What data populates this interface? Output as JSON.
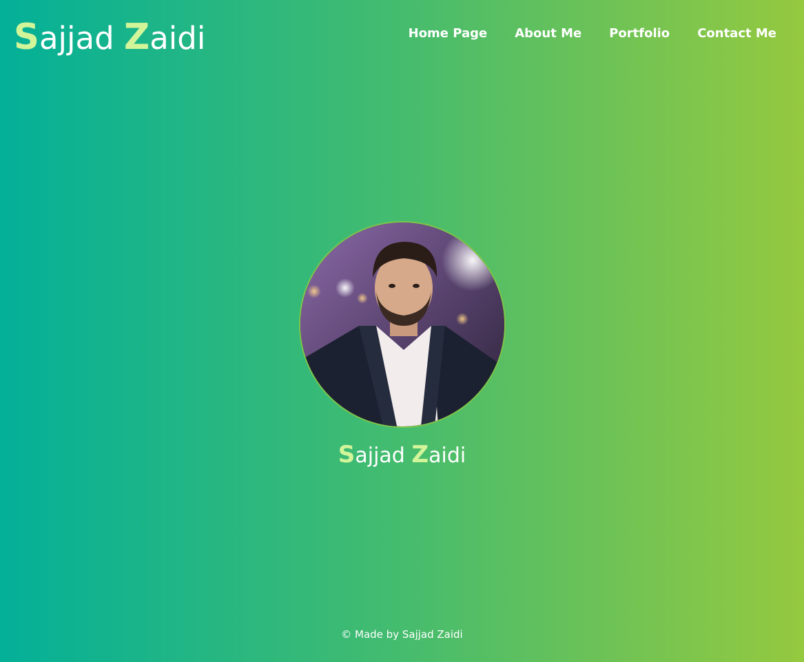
{
  "logo": {
    "first_initial": "S",
    "first_rest": "ajjad ",
    "last_initial": "Z",
    "last_rest": "aidi"
  },
  "nav": {
    "items": [
      {
        "label": "Home Page"
      },
      {
        "label": "About Me"
      },
      {
        "label": "Portfolio"
      },
      {
        "label": "Contact Me"
      }
    ]
  },
  "hero": {
    "first_initial": "S",
    "first_rest": "ajjad ",
    "last_initial": "Z",
    "last_rest": "aidi"
  },
  "footer": {
    "text": "© Made by Sajjad Zaidi"
  },
  "colors": {
    "gradient_start": "#03b098",
    "gradient_end": "#95c93f",
    "initial_accent": "#d2f59a",
    "text": "#ffffff"
  }
}
